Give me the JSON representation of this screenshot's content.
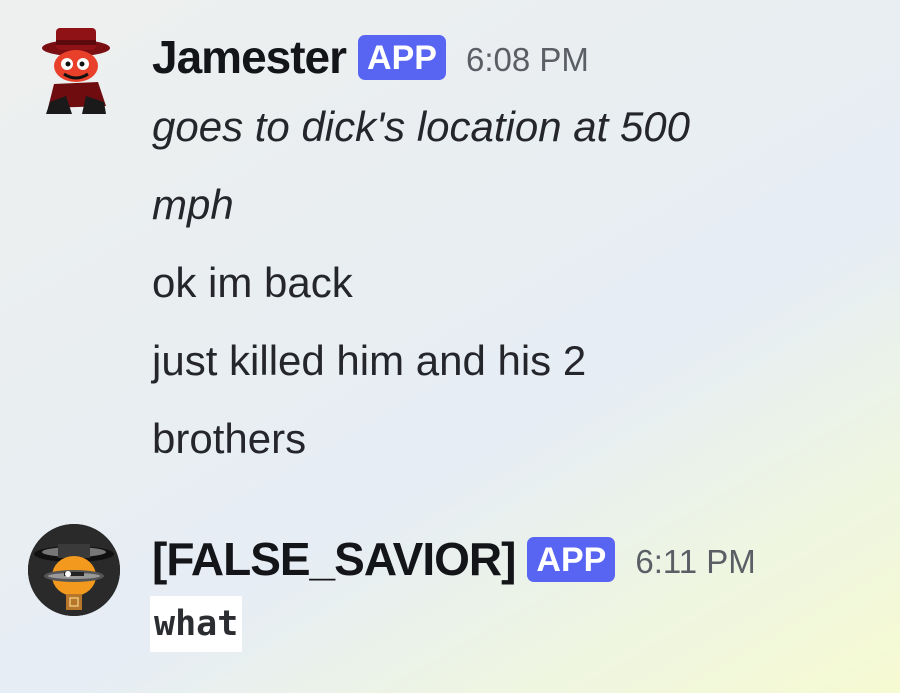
{
  "messages": [
    {
      "author": "Jamester",
      "badge": "APP",
      "time": "6:08 PM",
      "avatar_icon": "red-top-hat-character-avatar",
      "lines": {
        "italic_1": "goes to dick's location at 500",
        "italic_2": "mph",
        "line_3": "ok im back",
        "line_4": "just killed him and his 2",
        "line_5": "brothers"
      }
    },
    {
      "author": "[FALSE_SAVIOR]",
      "badge": "APP",
      "time": "6:11 PM",
      "avatar_icon": "orange-robot-eye-avatar",
      "code_text": "what"
    }
  ],
  "colors": {
    "badge_bg": "#5865f2",
    "badge_text": "#ffffff",
    "timestamp": "#5c5e66",
    "text": "#24262b"
  }
}
